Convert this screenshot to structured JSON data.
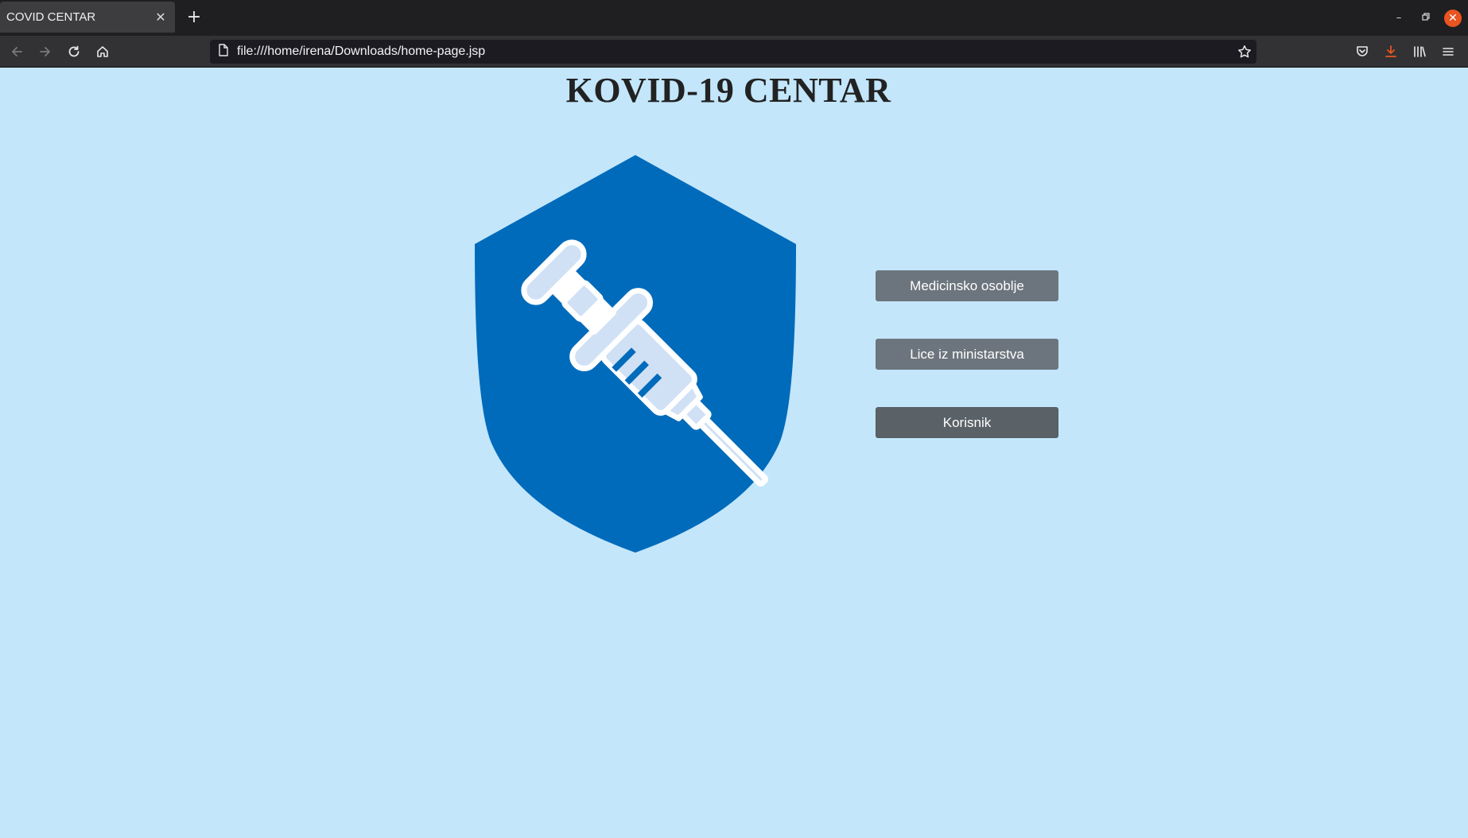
{
  "browser": {
    "tab_title": "COVID CENTAR",
    "url": "file:///home/irena/Downloads/home-page.jsp"
  },
  "page": {
    "title": "KOVID-19 CENTAR",
    "buttons": [
      {
        "label": "Medicinsko osoblje"
      },
      {
        "label": "Lice iz ministarstva"
      },
      {
        "label": "Korisnik"
      }
    ]
  },
  "colors": {
    "page_background": "#c3e6fb",
    "shield": "#006bbb",
    "syringe_light": "#d0e1f5",
    "button": "#6c757d",
    "button_active": "#5a6268",
    "window_close": "#e95420"
  },
  "icons": {
    "logo": "shield-syringe-icon"
  }
}
